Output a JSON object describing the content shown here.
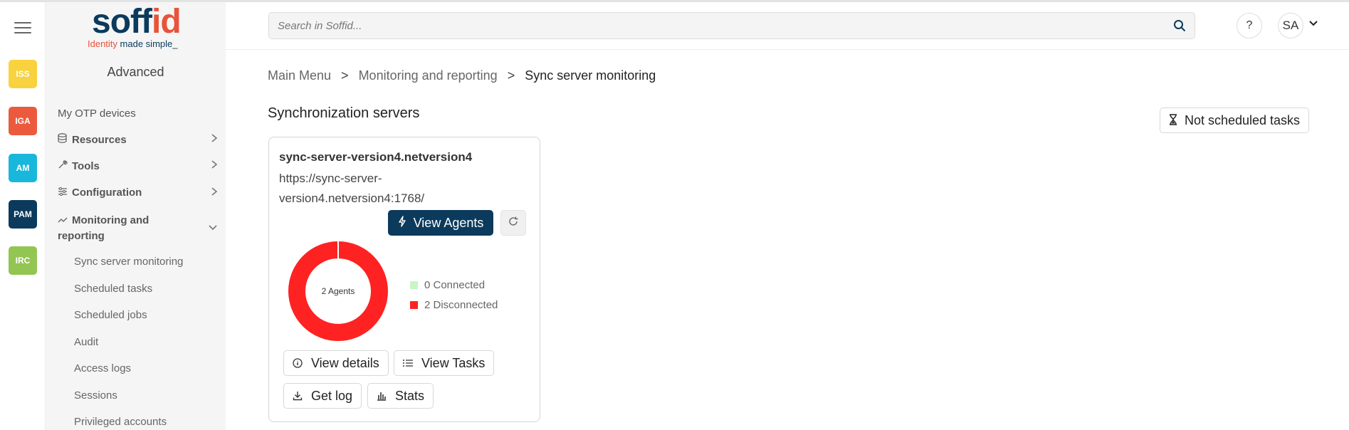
{
  "apps": [
    {
      "label": "ISS",
      "color": "#f8d23f"
    },
    {
      "label": "IGA",
      "color": "#ec5a3e"
    },
    {
      "label": "AM",
      "color": "#1ab7dc"
    },
    {
      "label": "PAM",
      "color": "#0b3a5c"
    },
    {
      "label": "IRC",
      "color": "#93c552"
    }
  ],
  "logo": {
    "brand_main": "soff",
    "brand_accent": "id",
    "tagline_accent": "Identity",
    "tagline_main": "made simple_"
  },
  "menu": {
    "title": "Advanced",
    "items": [
      {
        "label": "My OTP devices"
      },
      {
        "label": "Resources",
        "icon": "database-icon"
      },
      {
        "label": "Tools",
        "icon": "wrench-icon"
      },
      {
        "label": "Configuration",
        "icon": "sliders-icon"
      },
      {
        "label": "Monitoring and reporting",
        "icon": "chart-line-icon"
      }
    ],
    "subitems": [
      "Sync server monitoring",
      "Scheduled tasks",
      "Scheduled jobs",
      "Audit",
      "Access logs",
      "Sessions",
      "Privileged accounts"
    ]
  },
  "header": {
    "search_placeholder": "Search in Soffid...",
    "help_label": "?",
    "user_initials": "SA"
  },
  "breadcrumb": {
    "items": [
      "Main Menu",
      "Monitoring and reporting"
    ],
    "current": "Sync server monitoring",
    "separator": ">"
  },
  "section": {
    "title": "Synchronization servers",
    "not_scheduled_label": "Not scheduled tasks"
  },
  "server": {
    "name": "sync-server-version4.netversion4",
    "url": "https://sync-server-version4.netversion4:1768/",
    "view_agents_label": "View Agents",
    "donut_label": "2 Agents",
    "legend": [
      {
        "label": "0 Connected",
        "value": 0,
        "color": "#c7f5c7"
      },
      {
        "label": "2 Disconnected",
        "value": 2,
        "color": "#ff2222"
      }
    ],
    "buttons": {
      "details": "View details",
      "tasks": "View Tasks",
      "log": "Get log",
      "stats": "Stats"
    }
  },
  "colors": {
    "primary": "#0b3a5c",
    "accent": "#e8533a",
    "disconnected": "#ff2222",
    "connected": "#c7f5c7"
  }
}
